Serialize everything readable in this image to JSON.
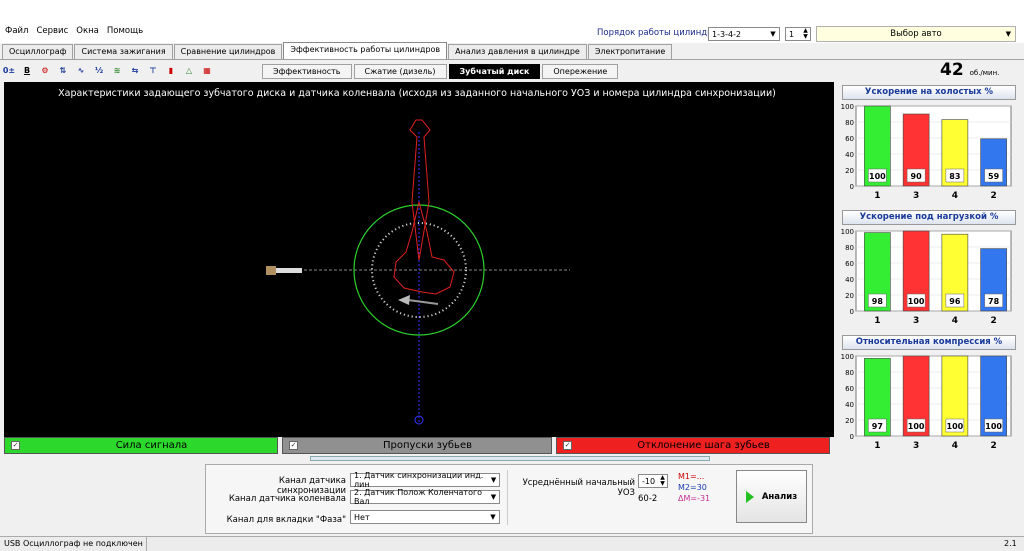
{
  "menu": [
    "Файл",
    "Сервис",
    "Окна",
    "Помощь"
  ],
  "cylinder_order": {
    "label": "Порядок работы цилиндров",
    "value": "1-3-4-2",
    "spin": "1"
  },
  "auto_select": "Выбор авто",
  "tabs": [
    "Осциллограф",
    "Система зажигания",
    "Сравнение цилиндров",
    "Эффективность работы цилиндров",
    "Анализ давления в цилиндре",
    "Электропитание"
  ],
  "subtabs": [
    "Эффективность",
    "Сжатие (дизель)",
    "Зубчатый диск",
    "Опережение"
  ],
  "rpm": {
    "value": "42",
    "unit": "об./мин."
  },
  "main_title": "Характеристики задающего зубчатого диска и датчика коленвала (исходя из заданного начального УОЗ и номера цилиндра синхронизации)",
  "buttons": {
    "signal": "Сила сигнала",
    "skips": "Пропуски зубьев",
    "deviation": "Отклонение шага зубьев"
  },
  "charts": [
    {
      "title": "Ускорение на холостых %",
      "categories": [
        "1",
        "3",
        "4",
        "2"
      ],
      "values": [
        100,
        90,
        83,
        59
      ],
      "colors": [
        "#33ee33",
        "#ff3333",
        "#ffff33",
        "#3377ee"
      ]
    },
    {
      "title": "Ускорение под нагрузкой %",
      "categories": [
        "1",
        "3",
        "4",
        "2"
      ],
      "values": [
        98,
        100,
        96,
        78
      ],
      "colors": [
        "#33ee33",
        "#ff3333",
        "#ffff33",
        "#3377ee"
      ]
    },
    {
      "title": "Относительная компрессия %",
      "categories": [
        "1",
        "3",
        "4",
        "2"
      ],
      "values": [
        97,
        100,
        100,
        100
      ],
      "colors": [
        "#33ee33",
        "#ff3333",
        "#ffff33",
        "#3377ee"
      ]
    }
  ],
  "y_ticks": [
    "100",
    "80",
    "60",
    "40",
    "20",
    "0"
  ],
  "form": {
    "sync_label": "Канал датчика синхронизации",
    "sync_value": "1. Датчик синхронизации инд. лин",
    "crank_label": "Канал датчика коленвала",
    "crank_value": "2. Датчик Полож Коленчатого Вал",
    "phase_label": "Канал для вкладки \"Фаза\"",
    "phase_value": "Нет",
    "uoz_label": "Усреднённый начальный УОЗ",
    "uoz_value": "-10",
    "tooth": "60-2",
    "m1": "M1=...",
    "m2": "M2=30",
    "dm": "ΔM=-31"
  },
  "analyze": "Анализ",
  "status": {
    "left": "USB Осциллограф не подключен",
    "right": "2.1"
  }
}
